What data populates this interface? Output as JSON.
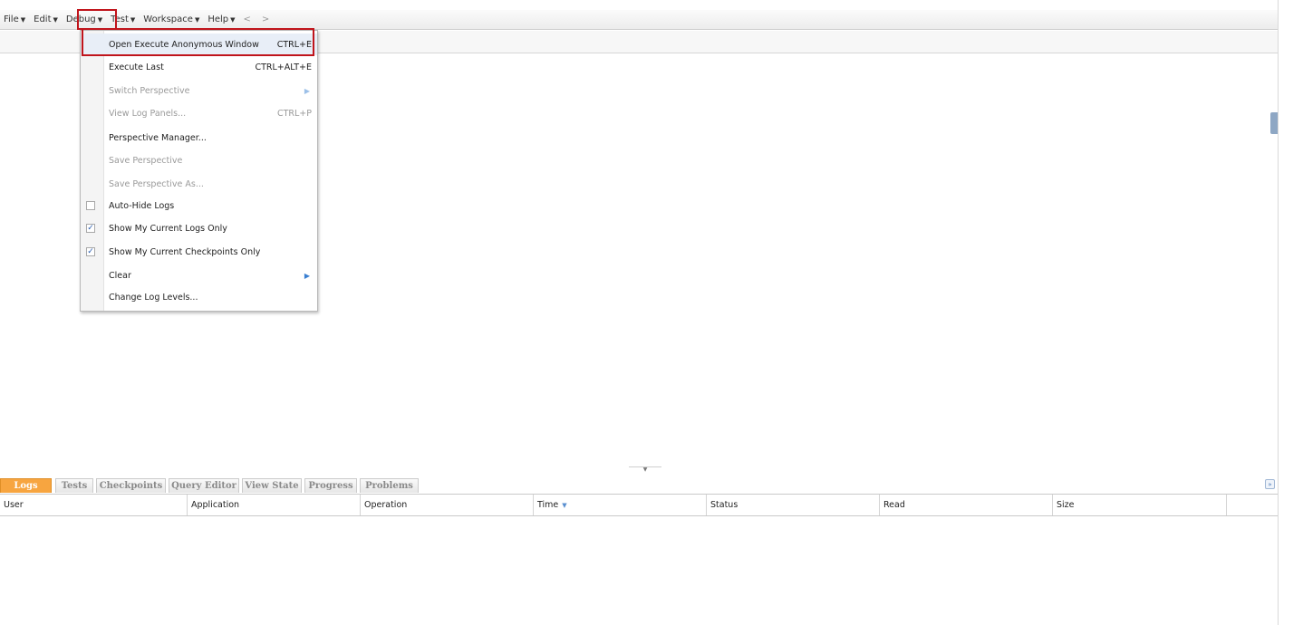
{
  "menubar": {
    "items": [
      {
        "label": "File"
      },
      {
        "label": "Edit"
      },
      {
        "label": "Debug"
      },
      {
        "label": "Test"
      },
      {
        "label": "Workspace"
      },
      {
        "label": "Help"
      }
    ],
    "back": "<",
    "forward": ">"
  },
  "debug_menu": {
    "items": [
      {
        "label": "Open Execute Anonymous Window",
        "shortcut": "CTRL+E",
        "enabled": true
      },
      {
        "label": "Execute Last",
        "shortcut": "CTRL+ALT+E",
        "enabled": true
      },
      {
        "label": "Switch Perspective",
        "submenu": true,
        "enabled": false
      },
      {
        "label": "View Log Panels...",
        "shortcut": "CTRL+P",
        "enabled": false
      },
      {
        "label": "Perspective Manager...",
        "enabled": true
      },
      {
        "label": "Save Perspective",
        "enabled": false
      },
      {
        "label": "Save Perspective As...",
        "enabled": false
      },
      {
        "label": "Auto-Hide Logs",
        "checkbox": true,
        "checked": false,
        "enabled": true
      },
      {
        "label": "Show My Current Logs Only",
        "checkbox": true,
        "checked": true,
        "enabled": true
      },
      {
        "label": "Show My Current Checkpoints Only",
        "checkbox": true,
        "checked": true,
        "enabled": true
      },
      {
        "label": "Clear",
        "submenu": true,
        "enabled": true
      },
      {
        "label": "Change Log Levels...",
        "enabled": true
      }
    ]
  },
  "bottom_tabs": [
    "Logs",
    "Tests",
    "Checkpoints",
    "Query Editor",
    "View State",
    "Progress",
    "Problems"
  ],
  "active_tab": "Logs",
  "log_table": {
    "columns": [
      "User",
      "Application",
      "Operation",
      "Time",
      "Status",
      "Read",
      "Size"
    ],
    "sorted_column": "Time"
  },
  "colors": {
    "active_tab": "#f7a540",
    "highlight_border": "#c0141b"
  }
}
